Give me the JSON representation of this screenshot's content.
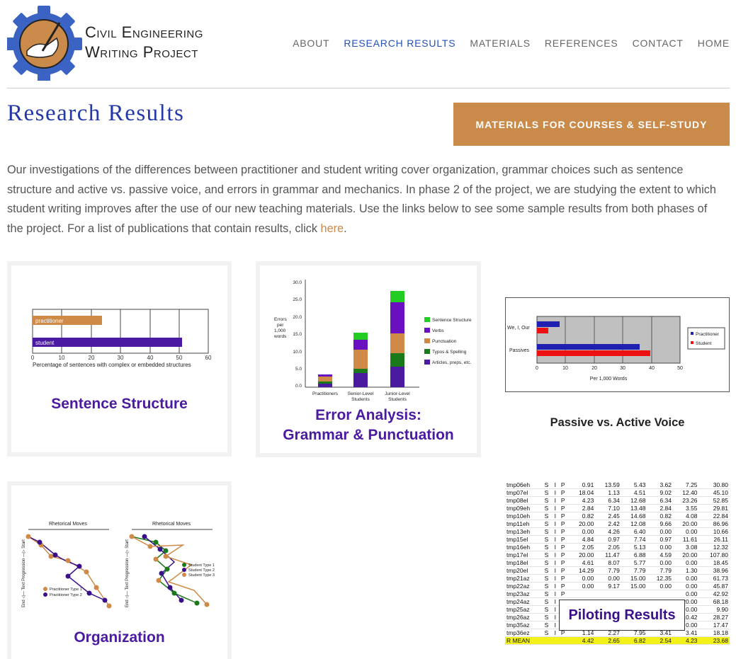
{
  "header": {
    "logo_line1": "Civil Engineering",
    "logo_line2": "Writing Project",
    "nav": [
      {
        "label": "ABOUT"
      },
      {
        "label": "RESEARCH RESULTS"
      },
      {
        "label": "MATERIALS"
      },
      {
        "label": "REFERENCES"
      },
      {
        "label": "CONTACT"
      },
      {
        "label": "HOME"
      }
    ]
  },
  "page": {
    "title": "Research Results",
    "materials_button": "MATERIALS FOR COURSES & SELF-STUDY",
    "intro_text": "Our investigations of the differences between practitioner and student writing cover organization, grammar choices such as sentence structure and active vs. passive voice, and errors in grammar and mechanics. In phase 2 of the project, we are studying the extent to which student writing improves after the use of our new teaching materials. Use the links below to see some sample results from both phases of the project. For a list of publications that contain results, click ",
    "intro_link": "here",
    "intro_end": "."
  },
  "colors": {
    "accent_blue": "#2450b8",
    "title_blue": "#2438a8",
    "button_orange": "#c98a4a",
    "caption_purple": "#4a1aa0"
  },
  "cards": {
    "sentence": {
      "caption": "Sentence Structure",
      "bar1": "practitioner",
      "bar2": "student",
      "ticks": [
        "0",
        "10",
        "20",
        "30",
        "40",
        "50",
        "60"
      ],
      "xlabel": "Percentage of sentences with complex or embedded structures"
    },
    "errors": {
      "caption1": "Error Analysis:",
      "caption2": "Grammar & Punctuation",
      "ylabel": [
        "Errors",
        "per",
        "1,000",
        "words"
      ],
      "yticks": [
        "30.0",
        "25.0",
        "20.0",
        "15.0",
        "10.0",
        "5.0",
        "0.0"
      ],
      "categories": [
        "Practitioners",
        "Senior-Level",
        "Junior-Level"
      ],
      "cat_line2": [
        "",
        "Students",
        "Students"
      ],
      "legend": [
        "Sentence Structure",
        "Verbs",
        "Punctuation",
        "Typos & Spelling",
        "Articles, preps, etc."
      ]
    },
    "passive": {
      "caption": "Passive vs. Active Voice",
      "cat1": "We, I, Our",
      "cat2": "Passives",
      "ticks": [
        "0",
        "10",
        "20",
        "30",
        "40",
        "50"
      ],
      "xlabel": "Per 1,000 Words",
      "legend": [
        "Practitioner",
        "Student"
      ]
    },
    "organization": {
      "caption": "Organization",
      "title_left": "Rhetorical Moves",
      "title_right": "Rhetorical Moves",
      "axis_label": "End ◁— Text Progression —▷ Start",
      "legend_left": [
        "Practitioner Type 1",
        "Practitioner Type 2"
      ],
      "legend_right": [
        "Student Type 1",
        "Student Type 2",
        "Student Type 3"
      ]
    },
    "piloting": {
      "caption": "Piloting Results",
      "rows": [
        [
          "tmp06eh",
          "S",
          "I",
          "P",
          "0.91",
          "13.59",
          "5.43",
          "3.62",
          "7.25",
          "30.80"
        ],
        [
          "tmp07el",
          "S",
          "I",
          "P",
          "18.04",
          "1.13",
          "4.51",
          "9.02",
          "12.40",
          "45.10"
        ],
        [
          "tmp08el",
          "S",
          "I",
          "P",
          "4.23",
          "6.34",
          "12.68",
          "6.34",
          "23.26",
          "52.85"
        ],
        [
          "tmp09eh",
          "S",
          "I",
          "P",
          "2.84",
          "7.10",
          "13.48",
          "2.84",
          "3.55",
          "29.81"
        ],
        [
          "tmp10eh",
          "S",
          "I",
          "P",
          "0.82",
          "2.45",
          "14.68",
          "0.82",
          "4.08",
          "22.84"
        ],
        [
          "tmp11eh",
          "S",
          "I",
          "P",
          "20.00",
          "2.42",
          "12.08",
          "9.66",
          "20.00",
          "86.96"
        ],
        [
          "tmp13eh",
          "S",
          "I",
          "P",
          "0.00",
          "4.26",
          "6.40",
          "0.00",
          "0.00",
          "10.66"
        ],
        [
          "tmp15el",
          "S",
          "I",
          "P",
          "4.84",
          "0.97",
          "7.74",
          "0.97",
          "11.61",
          "26.11"
        ],
        [
          "tmp16eh",
          "S",
          "I",
          "P",
          "2.05",
          "2.05",
          "5.13",
          "0.00",
          "3.08",
          "12.32"
        ],
        [
          "tmp17el",
          "S",
          "I",
          "P",
          "20.00",
          "11.47",
          "6.88",
          "4.59",
          "20.00",
          "107.80"
        ],
        [
          "tmp18el",
          "S",
          "I",
          "P",
          "4.61",
          "8.07",
          "5.77",
          "0.00",
          "0.00",
          "18.45"
        ],
        [
          "tmp20el",
          "S",
          "I",
          "P",
          "14.29",
          "7.79",
          "7.79",
          "7.79",
          "1.30",
          "38.96"
        ],
        [
          "tmp21az",
          "S",
          "I",
          "P",
          "0.00",
          "0.00",
          "15.00",
          "12.35",
          "0.00",
          "61.73"
        ],
        [
          "tmp22az",
          "S",
          "I",
          "P",
          "0.00",
          "9.17",
          "15.00",
          "0.00",
          "0.00",
          "45.87"
        ],
        [
          "tmp23az",
          "S",
          "I",
          "P",
          "",
          "",
          "",
          "",
          "0.00",
          "42.92"
        ],
        [
          "tmp24az",
          "S",
          "I",
          "P",
          "",
          "",
          "",
          "",
          "20.00",
          "68.18"
        ],
        [
          "tmp25az",
          "S",
          "I",
          "P",
          "",
          "",
          "",
          "",
          "0.00",
          "9.90"
        ],
        [
          "tmp26az",
          "S",
          "I",
          "P",
          "",
          "",
          "",
          "",
          "10.42",
          "28.27"
        ],
        [
          "tmp35az",
          "S",
          "I",
          "P",
          "",
          "",
          "",
          "",
          "0.00",
          "17.47"
        ],
        [
          "tmp36ez",
          "S",
          "I",
          "P",
          "1.14",
          "2.27",
          "7.95",
          "3.41",
          "3.41",
          "18.18"
        ]
      ],
      "mean_row": [
        "R MEAN",
        "",
        "",
        "",
        "4.42",
        "2.65",
        "6.82",
        "2.54",
        "4.23",
        "23.68"
      ]
    }
  }
}
